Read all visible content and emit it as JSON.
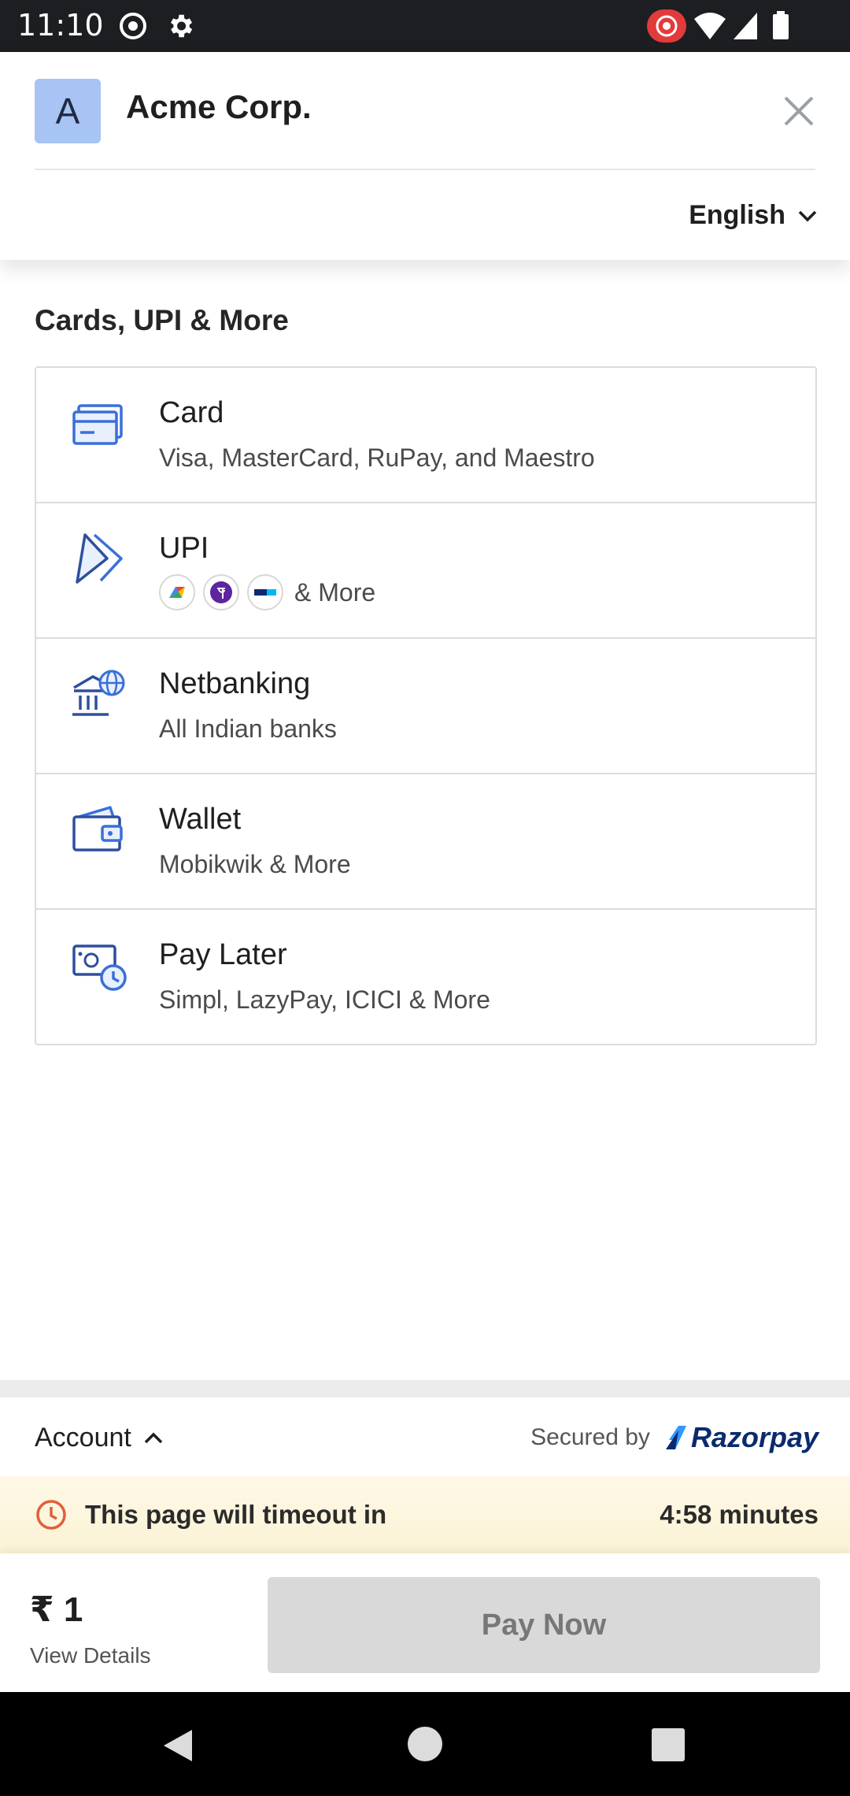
{
  "status_bar": {
    "time": "11:10"
  },
  "header": {
    "avatar_letter": "A",
    "merchant_name": "Acme Corp.",
    "language": "English"
  },
  "section": {
    "title": "Cards, UPI & More"
  },
  "methods": [
    {
      "title": "Card",
      "subtitle": "Visa, MasterCard, RuPay, and Maestro",
      "icon": "card-icon"
    },
    {
      "title": "UPI",
      "subtitle": "& More",
      "icon": "upi-icon"
    },
    {
      "title": "Netbanking",
      "subtitle": "All Indian banks",
      "icon": "bank-icon"
    },
    {
      "title": "Wallet",
      "subtitle": "Mobikwik & More",
      "icon": "wallet-icon"
    },
    {
      "title": "Pay Later",
      "subtitle": "Simpl, LazyPay, ICICI & More",
      "icon": "paylater-icon"
    }
  ],
  "upi_apps": [
    "google-pay-icon",
    "phonepe-icon",
    "paytm-icon"
  ],
  "footer": {
    "account_label": "Account",
    "secured_by": "Secured by",
    "brand": "Razorpay",
    "timeout_text": "This page will timeout in",
    "timeout_value": "4:58 minutes",
    "amount": "₹ 1",
    "view_details": "View Details",
    "pay_now": "Pay Now"
  },
  "colors": {
    "accent_icon": "#3a6fd8",
    "avatar_bg": "#a7c4f4",
    "brand_dark": "#0b2a6e",
    "timeout_bg": "#fff8e6",
    "timeout_icon": "#e0603a",
    "pay_button_disabled": "#d9d9d9"
  }
}
